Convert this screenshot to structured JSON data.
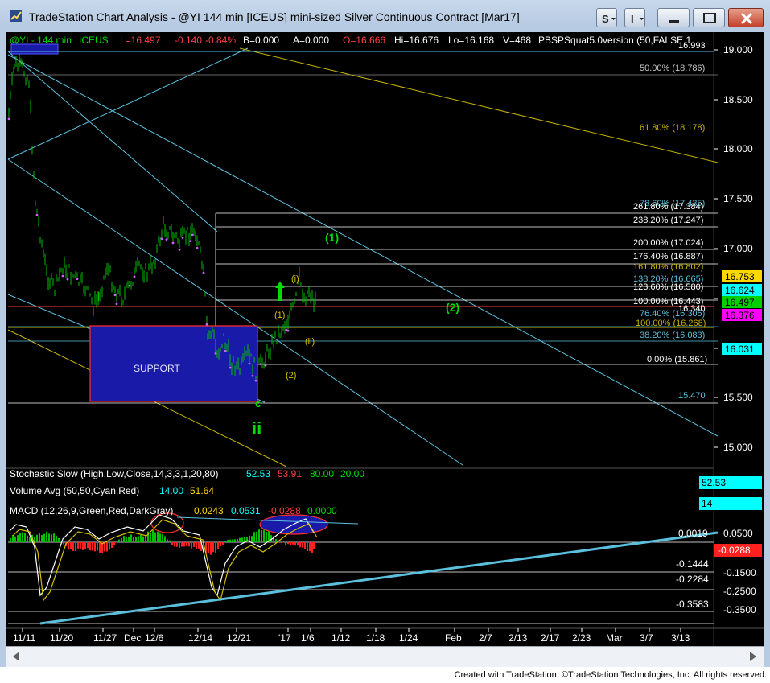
{
  "window": {
    "title": "TradeStation Chart Analysis - @YI 144 min [ICEUS] mini-sized Silver Continuous Contract [Mar17]",
    "status_text": "Created with TradeStation. ©TradeStation Technologies, Inc. All rights reserved.",
    "buttons": {
      "s_label": "S",
      "i_label": "I"
    }
  },
  "header": {
    "symbol": "@YI - 144 min",
    "exchange": "ICEUS",
    "last": "L=16.497",
    "change": "-0.140",
    "change_pct": "-0.84%",
    "bid": "B=0.000",
    "ask": "A=0.000",
    "open": "O=16.666",
    "high": "Hi=16.676",
    "low": "Lo=16.168",
    "volume": "V=468",
    "study": "PBSPSquat5.0version (50,FALSE,1"
  },
  "colors": {
    "background": "#000000",
    "price_up": "#00c000",
    "fib_line": "#ffffff",
    "channel": "#5bc0de",
    "trend_yellow": "#c8b400",
    "support_box": "#1a1aa8",
    "accent_green": "#00dd00",
    "wave_label": "#d6c000"
  },
  "price_axis": {
    "ticks": [
      "19.000",
      "18.500",
      "18.000",
      "17.500",
      "17.000",
      "16.500",
      "16.000",
      "15.500",
      "15.000"
    ],
    "badges": [
      {
        "text": "16.753",
        "bg": "#ffd700",
        "fg": "#000000"
      },
      {
        "text": "16.624",
        "bg": "#00ffff",
        "fg": "#000000"
      },
      {
        "text": "16.497",
        "bg": "#00d000",
        "fg": "#000000"
      },
      {
        "text": "16.376",
        "bg": "#ff00ff",
        "fg": "#000000"
      },
      {
        "text": "16.031",
        "bg": "#00ffff",
        "fg": "#000000"
      }
    ]
  },
  "fib_labels": [
    {
      "text": "16.993",
      "color": "#ffffff"
    },
    {
      "text": "50.00% (18.786)",
      "color": "#c8c8c8"
    },
    {
      "text": "61.80% (18.178)",
      "color": "#c8b400"
    },
    {
      "text": "78.60% (17.435)",
      "color": "#5bc0de"
    },
    {
      "text": "261.80% (17.384)",
      "color": "#ffffff"
    },
    {
      "text": "238.20% (17.247)",
      "color": "#ffffff"
    },
    {
      "text": "200.00% (17.024)",
      "color": "#ffffff"
    },
    {
      "text": "176.40% (16.887)",
      "color": "#ffffff"
    },
    {
      "text": "161.80% (16.802)",
      "color": "#c8b400"
    },
    {
      "text": "138.20% (16.665)",
      "color": "#5bc0de"
    },
    {
      "text": "123.60% (16.580)",
      "color": "#ffffff"
    },
    {
      "text": "100.00% (16.443)",
      "color": "#ffffff"
    },
    {
      "text": "16.340",
      "color": "#ffffff"
    },
    {
      "text": "76.40% (16.305)",
      "color": "#5bc0de"
    },
    {
      "text": "100.00% (16.268)",
      "color": "#c8b400"
    },
    {
      "text": "38.20% (16.083)",
      "color": "#5bc0de"
    },
    {
      "text": "0.00% (15.861)",
      "color": "#ffffff"
    },
    {
      "text": "15.470",
      "color": "#5bc0de"
    }
  ],
  "annotations": {
    "support": "SUPPORT",
    "wave_1_green": "(1)",
    "wave_2_green": "(2)",
    "wave_c": "c",
    "wave_ii": "ii",
    "wave_1_small": "(1)",
    "wave_2_small": "(2)",
    "wave_i": "(i)",
    "wave_ii_small": "(ii)"
  },
  "stochastic": {
    "label": "Stochastic Slow (High,Low,Close,14,3,3,1,20,80)",
    "k": "52.53",
    "d": "53.91",
    "ob": "80.00",
    "os": "20.00",
    "badge": "52.53"
  },
  "volume": {
    "label": "Volume Avg (50,50,Cyan,Red)",
    "v1": "14.00",
    "v2": "51.64",
    "badge": "14"
  },
  "macd": {
    "label": "MACD (12,26,9,Green,Red,DarkGray)",
    "macd": "0.0243",
    "signal": "0.0531",
    "diff": "-0.0288",
    "zero": "0.0000",
    "axis_ticks": [
      "0.0500",
      "-0.1500",
      "-0.2500",
      "-0.3500"
    ],
    "levels": [
      "0.0019",
      "-0.1444",
      "-0.2284",
      "-0.3583"
    ],
    "badge": "-0.0288"
  },
  "time_axis": {
    "ticks": [
      "11/11",
      "11/20",
      "11/27",
      "Dec",
      "12/6",
      "12/14",
      "12/21",
      "'17",
      "1/6",
      "1/12",
      "1/18",
      "1/24",
      "Feb",
      "2/7",
      "2/13",
      "2/17",
      "2/23",
      "Mar",
      "3/7",
      "3/13"
    ]
  }
}
